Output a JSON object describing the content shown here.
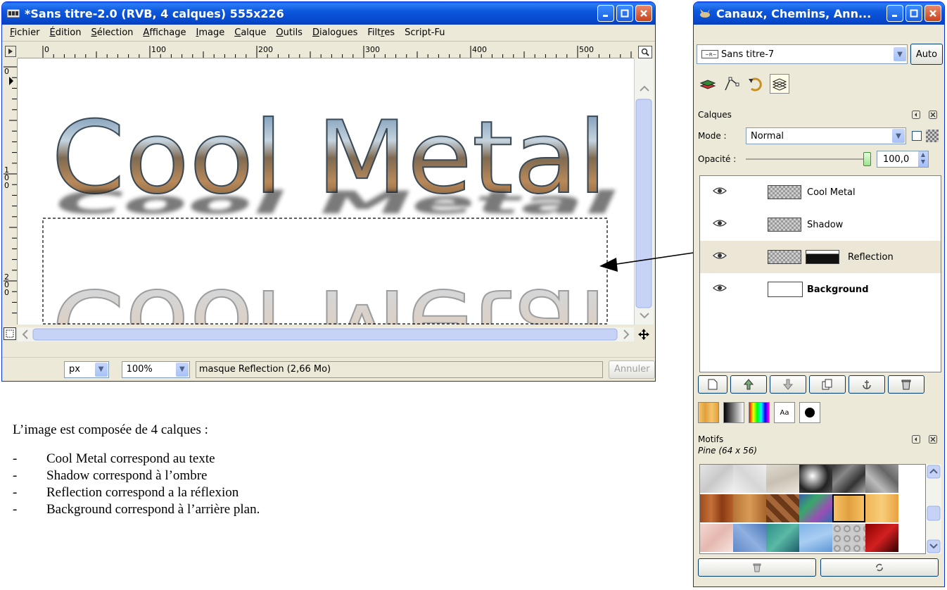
{
  "image_window": {
    "title": "*Sans titre-2.0 (RVB, 4 calques) 555x226",
    "menu": [
      {
        "u": "F",
        "rest": "ichier"
      },
      {
        "u": "É",
        "rest": "dition"
      },
      {
        "u": "S",
        "rest": "élection"
      },
      {
        "u": "A",
        "rest": "ffichage"
      },
      {
        "u": "I",
        "rest": "mage"
      },
      {
        "u": "C",
        "rest": "alque"
      },
      {
        "u": "O",
        "rest": "utils"
      },
      {
        "u": "D",
        "rest": "ialogues"
      },
      {
        "pre": "Filt",
        "u": "r",
        "rest": "es"
      },
      {
        "pre": "Script-Fu",
        "u": "",
        "rest": ""
      }
    ],
    "ruler_h_labels": [
      "0",
      "100",
      "200",
      "300",
      "400",
      "500"
    ],
    "ruler_v_labels": [
      "0",
      "100",
      "200"
    ],
    "canvas_text": "Cool Metal",
    "unit": "px",
    "zoom": "100%",
    "status_text": "masque Reflection (2,66 Mo)",
    "cancel_label": "Annuler"
  },
  "layers_dialog": {
    "title": "Canaux, Chemins, Ann...",
    "image_select": "Sans titre-7",
    "auto_label": "Auto",
    "section_label": "Calques",
    "mode_label": "Mode :",
    "mode_value": "Normal",
    "opacity_label": "Opacité :",
    "opacity_value": "100,0",
    "opacity_fraction": 1.0,
    "layers": [
      {
        "name": "Cool Metal",
        "bold": false,
        "has_mask": false,
        "active": false
      },
      {
        "name": "Shadow",
        "bold": false,
        "has_mask": false,
        "active": false
      },
      {
        "name": "Reflection",
        "bold": false,
        "has_mask": true,
        "active": true
      },
      {
        "name": "Background",
        "bold": true,
        "has_mask": false,
        "active": false
      }
    ],
    "patterns_label": "Motifs",
    "pattern_name": "Pine (64 x 56)"
  },
  "description": {
    "intro": "L’image est composée de 4 calques :",
    "items": [
      "Cool Metal correspond au texte",
      "Shadow correspond à l’ombre",
      "Reflection correspond a la réflexion",
      "Background correspond à l’arrière plan."
    ]
  },
  "colors": {
    "xp_blue": "#0a5fe8",
    "selection_row": "#ebe6d6"
  }
}
